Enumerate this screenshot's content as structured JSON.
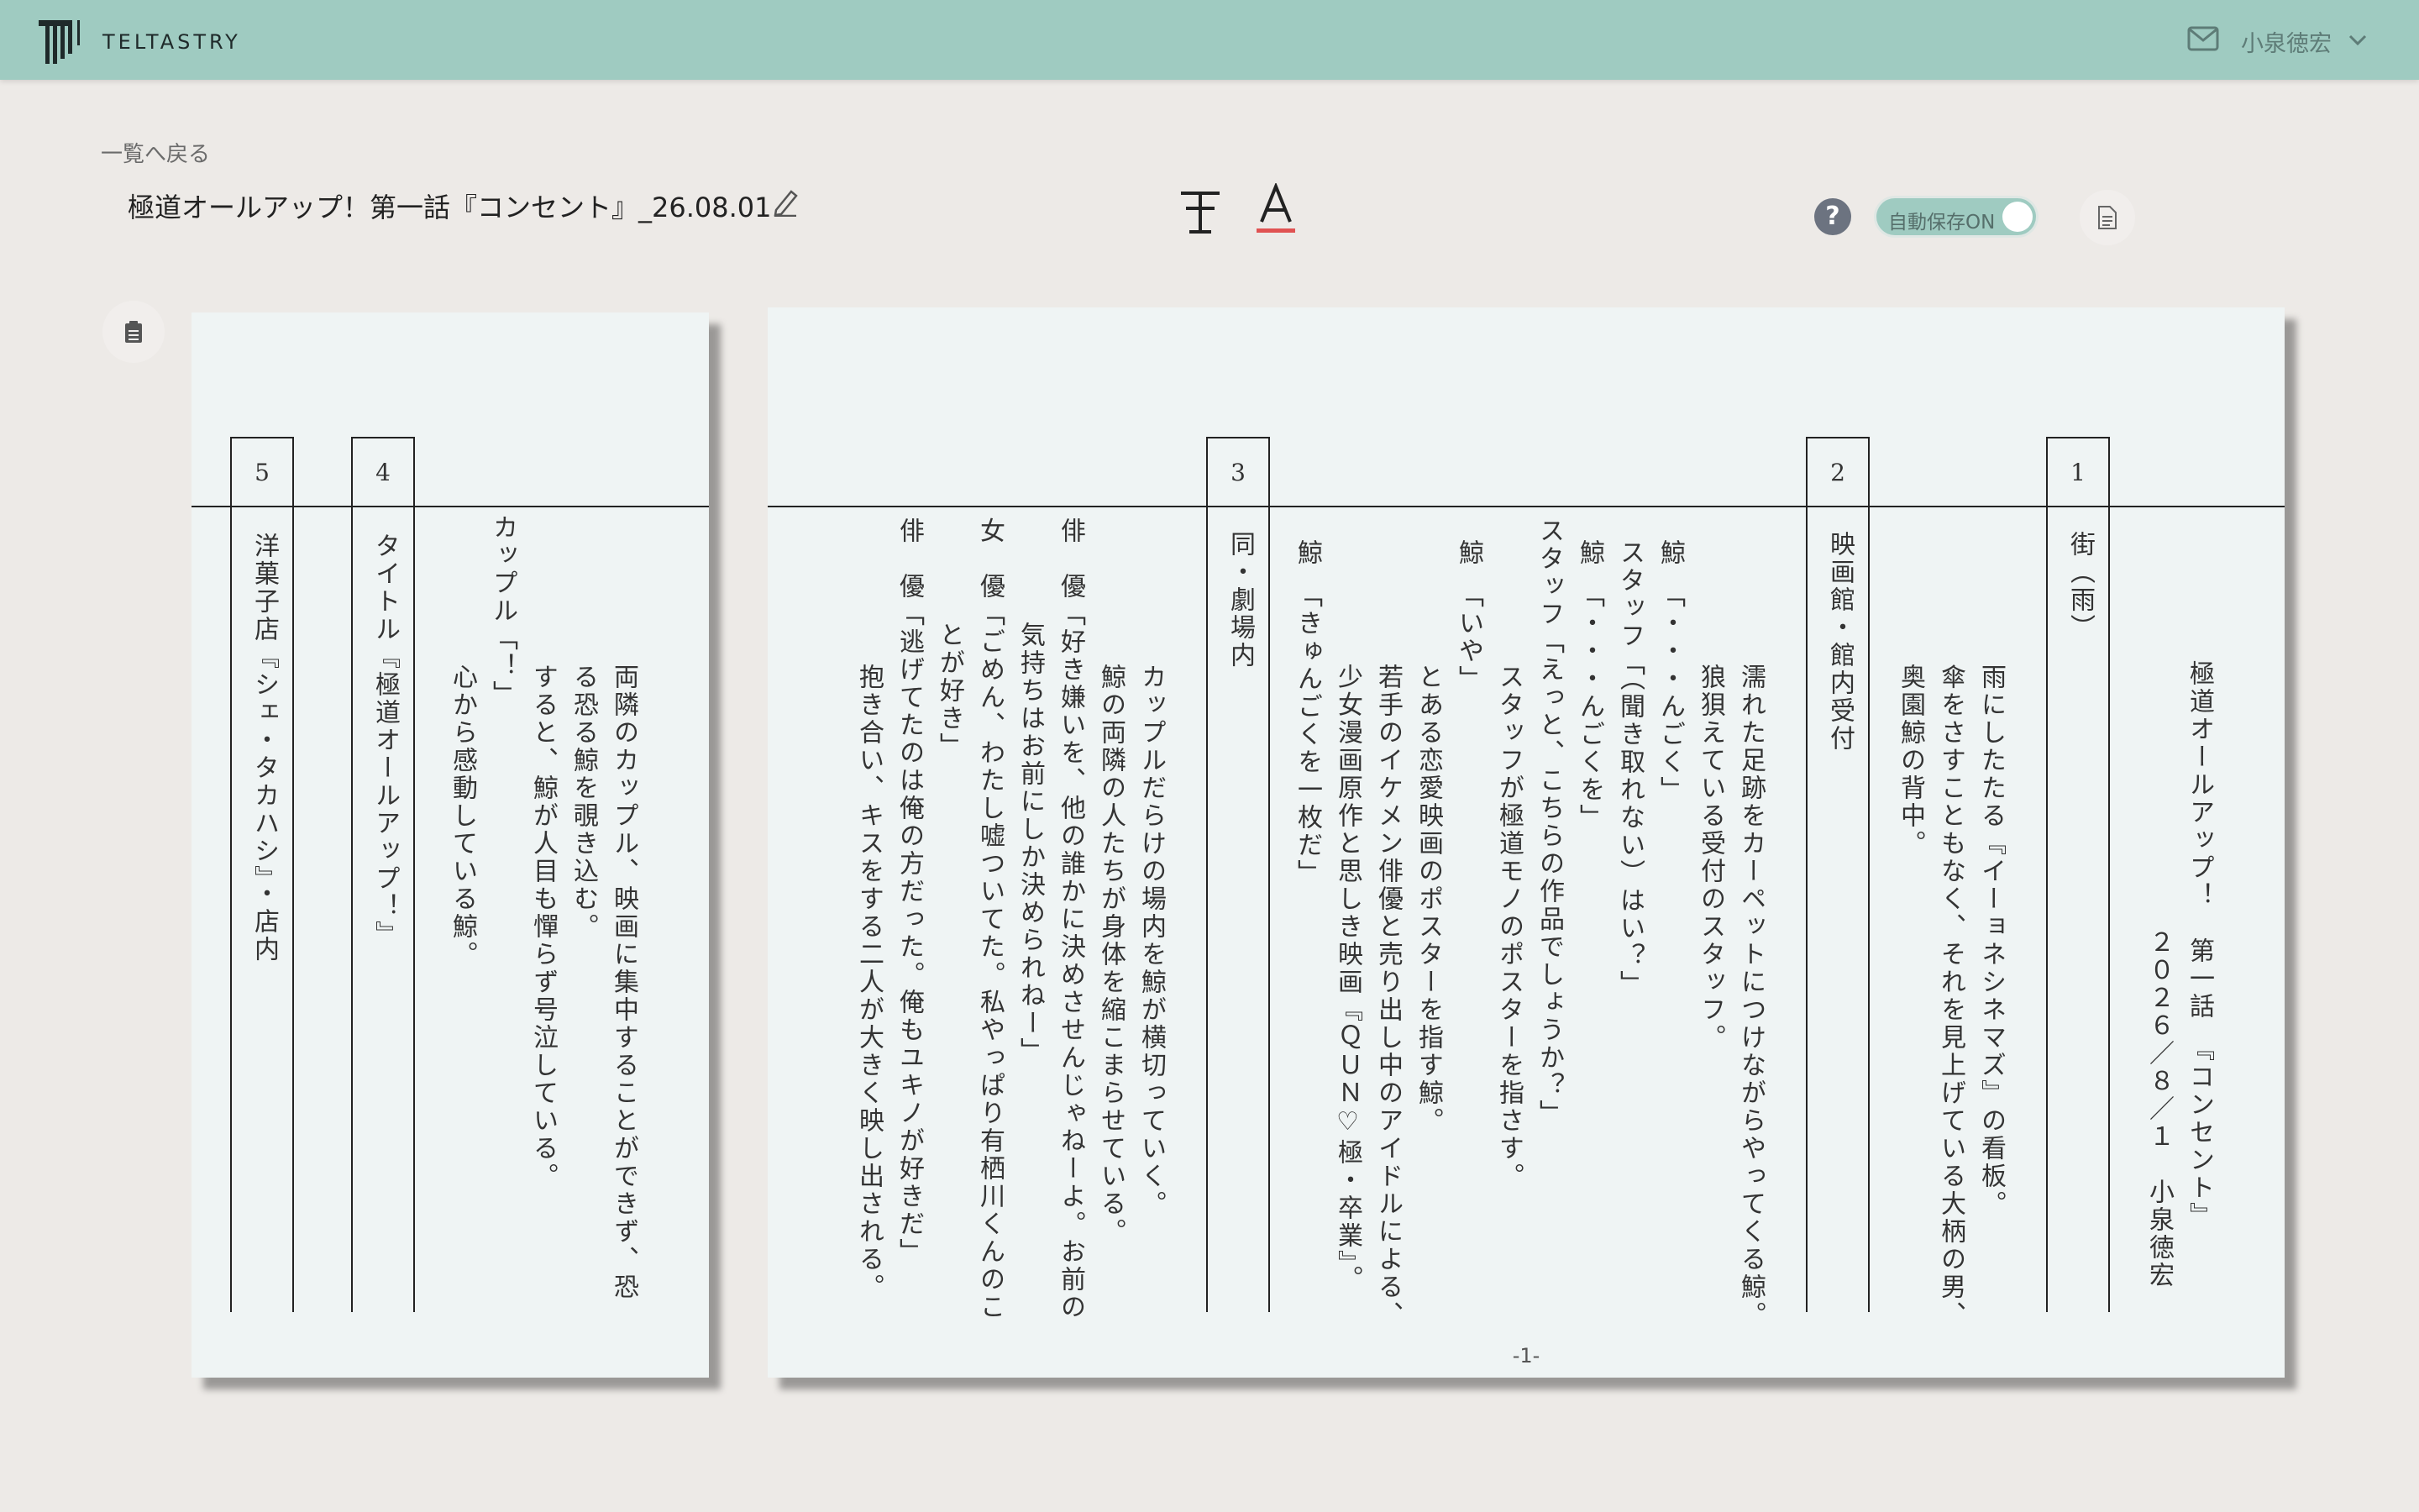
{
  "header": {
    "logo_text": "TELTASTRY",
    "user_name": "小泉徳宏"
  },
  "toolbar": {
    "back_label": "一覧へ戻る",
    "document_title": "極道オールアップ！第一話『コンセント』_26.08.01",
    "help_label": "?",
    "autosave_label": "自動保存ON"
  },
  "script": {
    "page_number": "-1-",
    "scene_numbers": [
      "1",
      "2",
      "3",
      "4",
      "5"
    ],
    "headings": {
      "s1": "街（雨）",
      "s2": "映画館・館内受付",
      "s3": "同・劇場内",
      "s4": "タイトル『極道オールアップ！』",
      "s5": "洋菓子店『シェ・タカハシ』・店内"
    },
    "title_block": {
      "line1": "極道オールアップ！　第一話　『コンセント』",
      "line2": "２０２６／８／１　小泉徳宏"
    },
    "lines": {
      "r1": "雨にしたたる『イーョネシネマズ』の看板。",
      "r2": "傘をさすこともなく、それを見上げている大柄の男、",
      "r3": "奥園鯨の背中。",
      "r4": "濡れた足跡をカーペットにつけながらやってくる鯨。",
      "r5": "狼狽えている受付のスタッフ。",
      "r6": "鯨　「・・・んごく」",
      "r7": "スタッフ「（聞き取れない）はい？」",
      "r8": "鯨　「・・・んごくを」",
      "r9": "スタッフ「えっと、こちらの作品でしょうか？」",
      "r10": "スタッフが極道モノのポスターを指さす。",
      "r11": "鯨　「いや」",
      "r12": "とある恋愛映画のポスターを指す鯨。",
      "r13": "若手のイケメン俳優と売り出し中のアイドルによる、",
      "r14": "少女漫画原作と思しき映画『ＱＵＮ♡極・卒業』。",
      "r15": "鯨　「きゅんごくを一枚だ」",
      "r16": "カップルだらけの場内を鯨が横切っていく。",
      "r17": "鯨の両隣の人たちが身体を縮こまらせている。",
      "r18": "俳　優「好き嫌いを、他の誰かに決めさせんじゃねーよ。お前の",
      "r19": "気持ちはお前にしか決められねー」",
      "r20": "女　優「ごめん、わたし嘘ついてた。私やっぱり有栖川くんのこ",
      "r21": "とが好き」",
      "r22": "俳　優「逃げてたのは俺の方だった。俺もユキノが好きだ」",
      "r23": "抱き合い、キスをする二人が大きく映し出される。",
      "l1": "両隣のカップル、映画に集中することができず、恐",
      "l2": "る恐る鯨を覗き込む。",
      "l3": "すると、鯨が人目も憚らず号泣している。",
      "l4": "カップル「！」",
      "l5": "心から感動している鯨。"
    }
  }
}
